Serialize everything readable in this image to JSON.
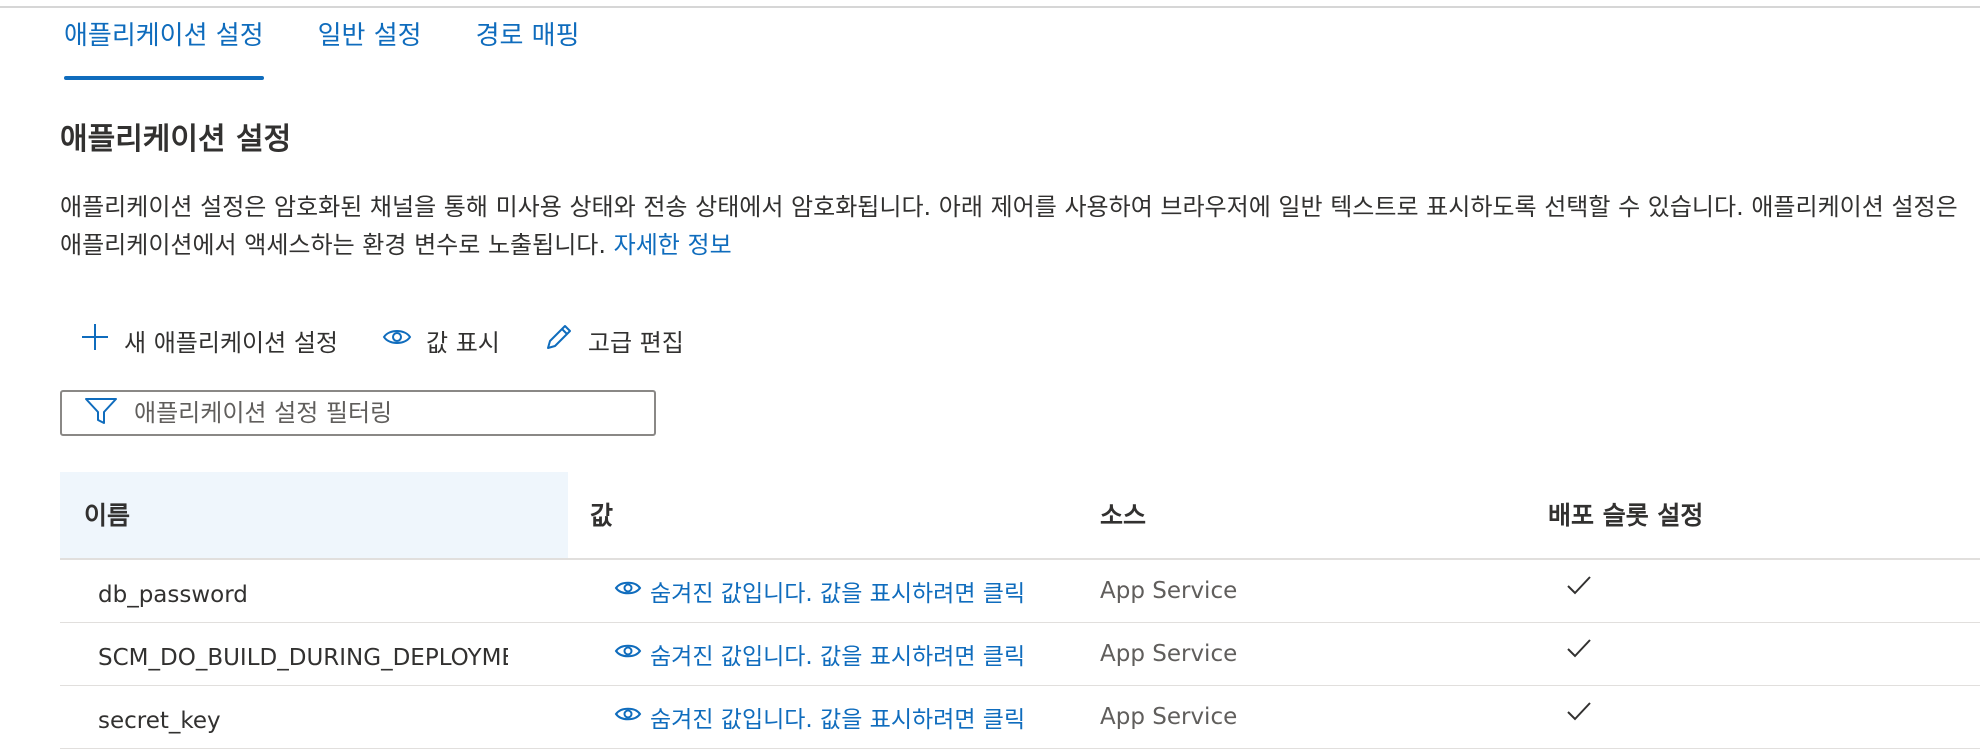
{
  "tabs": [
    {
      "label": "애플리케이션 설정",
      "active": true
    },
    {
      "label": "일반 설정",
      "active": false
    },
    {
      "label": "경로 매핑",
      "active": false
    }
  ],
  "section_title": "애플리케이션 설정",
  "description": {
    "line1": "애플리케이션 설정은 암호화된 채널을 통해 미사용 상태와 전송 상태에서 암호화됩니다. 아래 제어를 사용하여 브라우저에 일반 텍스트로 표시하도록 선택할 수 있습니다. 애플리케이션 설정은",
    "line2": "애플리케이션에서 액세스하는 환경 변수로 노출됩니다. ",
    "link": "자세한 정보"
  },
  "toolbar": {
    "new_setting": "새 애플리케이션 설정",
    "show_values": "값 표시",
    "advanced_edit": "고급 편집"
  },
  "filter": {
    "placeholder": "애플리케이션 설정 필터링",
    "value": ""
  },
  "columns": {
    "name": "이름",
    "value": "값",
    "source": "소스",
    "slot": "배포 슬롯 설정"
  },
  "rows": [
    {
      "name": "db_password",
      "value": "숨겨진 값입니다. 값을 표시하려면 클릭",
      "source": "App Service",
      "slot_setting": true
    },
    {
      "name": "SCM_DO_BUILD_DURING_DEPLOYMENT",
      "value": "숨겨진 값입니다. 값을 표시하려면 클릭",
      "source": "App Service",
      "slot_setting": true
    },
    {
      "name": "secret_key",
      "value": "숨겨진 값입니다. 값을 표시하려면 클릭",
      "source": "App Service",
      "slot_setting": true
    }
  ],
  "colors": {
    "accent": "#0f6cbd",
    "header_bg": "#eff6fc"
  }
}
